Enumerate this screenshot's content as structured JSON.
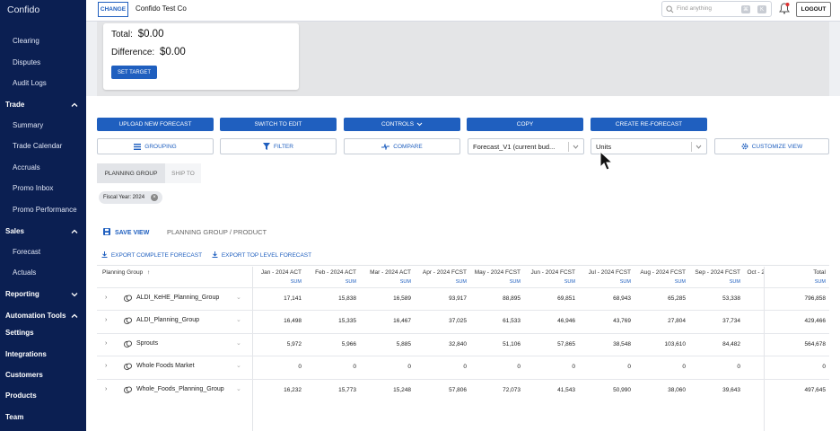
{
  "sidebar": {
    "brand": "Confido",
    "items": [
      {
        "label": "Clearing",
        "type": "item"
      },
      {
        "label": "Disputes",
        "type": "item"
      },
      {
        "label": "Audit Logs",
        "type": "item"
      },
      {
        "label": "Trade",
        "type": "section",
        "chevron": "chevron-up-icon"
      },
      {
        "label": "Summary",
        "type": "item"
      },
      {
        "label": "Trade Calendar",
        "type": "item"
      },
      {
        "label": "Accruals",
        "type": "item"
      },
      {
        "label": "Promo Inbox",
        "type": "item"
      },
      {
        "label": "Promo Performance",
        "type": "item"
      },
      {
        "label": "Sales",
        "type": "section",
        "chevron": "chevron-up-icon"
      },
      {
        "label": "Forecast",
        "type": "item"
      },
      {
        "label": "Actuals",
        "type": "item"
      },
      {
        "label": "Reporting",
        "type": "section",
        "chevron": "chevron-down-icon"
      },
      {
        "label": "Automation Tools",
        "type": "section",
        "chevron": "chevron-up-icon"
      },
      {
        "label": "Settings",
        "type": "section"
      },
      {
        "label": "Integrations",
        "type": "section"
      },
      {
        "label": "Customers",
        "type": "section"
      },
      {
        "label": "Products",
        "type": "section"
      },
      {
        "label": "Team",
        "type": "section"
      }
    ]
  },
  "header": {
    "change_label": "CHANGE",
    "company": "Confido Test Co",
    "search_placeholder": "Find anything",
    "kbd_1": "⌘",
    "kbd_2": "K",
    "logout_label": "LOGOUT"
  },
  "target_card": {
    "total_label": "Total:",
    "total_value": "$0.00",
    "difference_label": "Difference:",
    "difference_value": "$0.00",
    "set_target_label": "SET TARGET"
  },
  "toolbar": {
    "upload_label": "UPLOAD NEW FORECAST",
    "switch_label": "SWITCH TO EDIT",
    "controls_label": "CONTROLS",
    "copy_label": "COPY",
    "reforecast_label": "CREATE RE-FORECAST",
    "grouping_label": "GROUPING",
    "filter_label": "FILTER",
    "compare_label": "COMPARE",
    "forecast_select": "Forecast_V1 (current bud...",
    "units_select": "Units",
    "customize_label": "CUSTOMIZE VIEW"
  },
  "segments": {
    "planning_group": "PLANNING GROUP",
    "ship_to": "SHIP TO"
  },
  "chip": {
    "label": "Fiscal Year: 2024",
    "close": "×"
  },
  "view": {
    "save_label": "SAVE VIEW",
    "breadcrumb": "PLANNING GROUP / PRODUCT",
    "export_complete": "EXPORT COMPLETE FORECAST",
    "export_top": "EXPORT TOP LEVEL FORECAST"
  },
  "table": {
    "first_col": "Planning Group",
    "sort_icon": "↑",
    "sum_label": "SUM",
    "columns": [
      "Jan - 2024 ACT",
      "Feb - 2024 ACT",
      "Mar - 2024 ACT",
      "Apr - 2024 FCST",
      "May - 2024 FCST",
      "Jun - 2024 FCST",
      "Jul - 2024 FCST",
      "Aug - 2024 FCST",
      "Sep - 2024 FCST",
      "Oct - 2",
      "Total"
    ],
    "rows": [
      {
        "name": "ALDI_KeHE_Planning_Group",
        "values": [
          "17,141",
          "15,838",
          "16,589",
          "93,917",
          "88,895",
          "69,851",
          "68,943",
          "65,285",
          "53,338",
          "",
          "796,858"
        ]
      },
      {
        "name": "ALDI_Planning_Group",
        "values": [
          "16,498",
          "15,335",
          "16,467",
          "37,025",
          "61,533",
          "46,946",
          "43,769",
          "27,804",
          "37,734",
          "",
          "429,466"
        ]
      },
      {
        "name": "Sprouts",
        "values": [
          "5,972",
          "5,966",
          "5,885",
          "32,840",
          "51,106",
          "57,865",
          "38,548",
          "103,610",
          "84,482",
          "",
          "564,678"
        ]
      },
      {
        "name": "Whole Foods Market",
        "values": [
          "0",
          "0",
          "0",
          "0",
          "0",
          "0",
          "0",
          "0",
          "0",
          "",
          "0"
        ]
      },
      {
        "name": "Whole_Foods_Planning_Group",
        "values": [
          "16,232",
          "15,773",
          "15,248",
          "57,806",
          "72,073",
          "41,543",
          "50,990",
          "38,060",
          "39,643",
          "",
          "497,645"
        ]
      }
    ]
  }
}
